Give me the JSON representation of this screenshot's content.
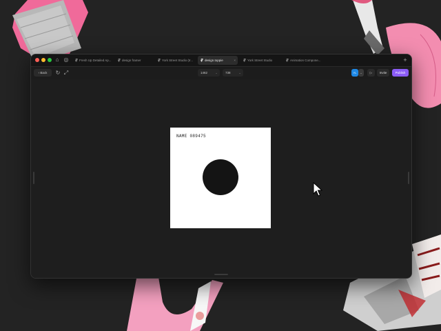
{
  "colors": {
    "background": "#232323",
    "accent_publish": "#8b5cf6",
    "accent_avatar": "#1e88e5",
    "tape_pink": "#f06a9a",
    "traffic_red": "#ff5f57",
    "traffic_yellow": "#febc2e",
    "traffic_green": "#28c840"
  },
  "window": {
    "tabs": [
      {
        "label": "Fresh Up Detailed Ap...",
        "icon": "framer-logo-icon",
        "active": false
      },
      {
        "label": "design framer",
        "icon": "framer-logo-icon",
        "active": false
      },
      {
        "label": "York Street Studio (tr...",
        "icon": "framer-logo-icon",
        "active": false
      },
      {
        "label": "design.toppie",
        "icon": "framer-logo-icon",
        "active": true
      },
      {
        "label": "York Street Studio",
        "icon": "framer-logo-icon",
        "active": false
      },
      {
        "label": "Animation Compone...",
        "icon": "framer-logo-icon",
        "active": false
      }
    ],
    "new_tab_label": "+",
    "close_label": "×"
  },
  "toolbar": {
    "back_label": "Back",
    "width_value": "1462",
    "height_value": "738",
    "avatar_initials": "YL",
    "invite_label": "Invite",
    "publish_label": "Publish"
  },
  "canvas": {
    "frame_label": "NAME 089475"
  }
}
